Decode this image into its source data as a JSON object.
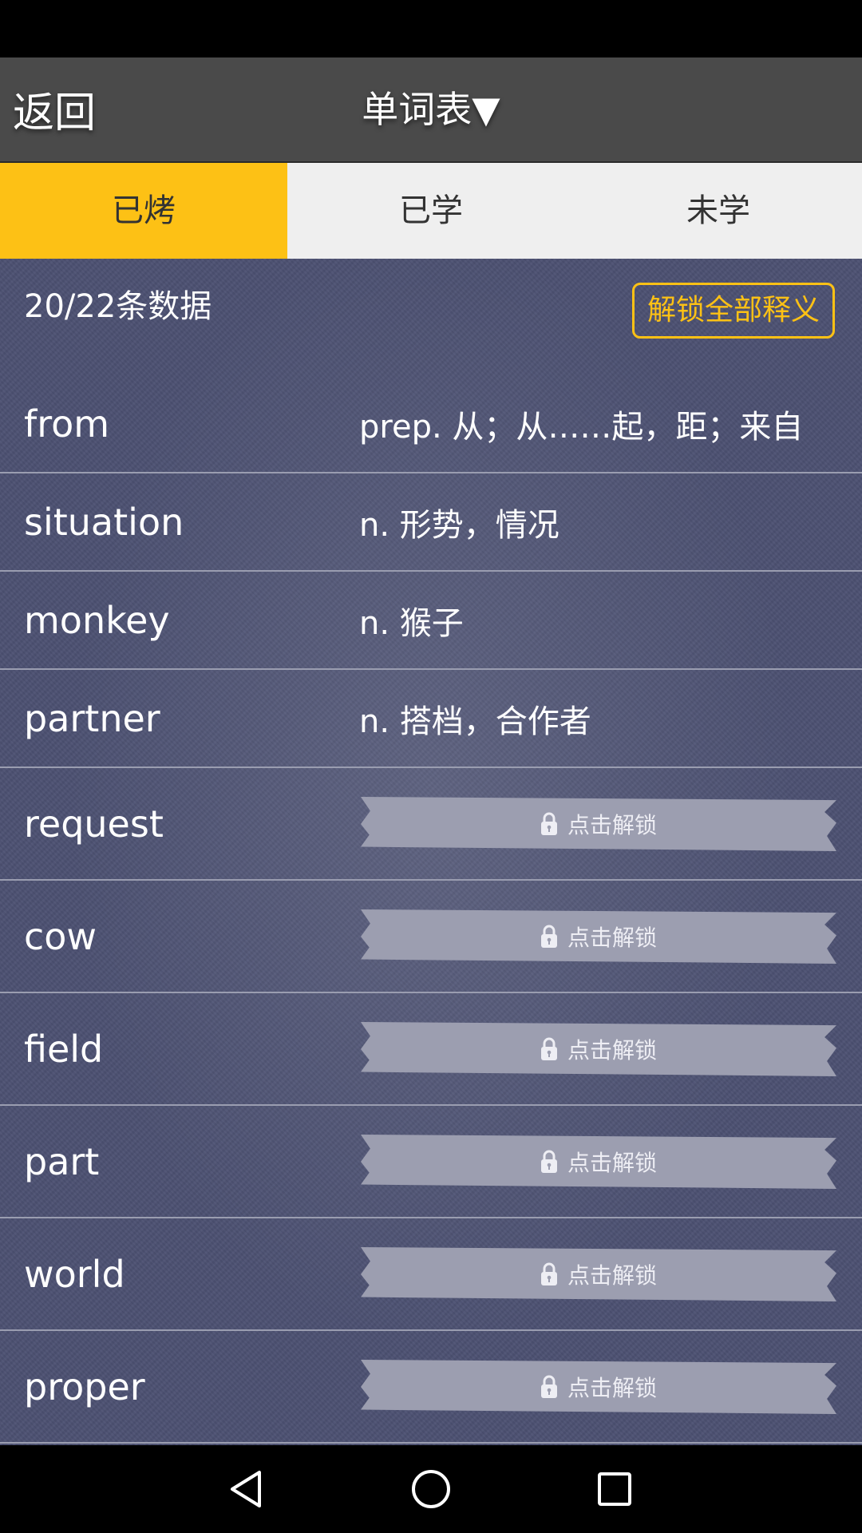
{
  "header": {
    "back_label": "返回",
    "title": "单词表",
    "dropdown_glyph": "▼"
  },
  "tabs": [
    {
      "label": "已烤",
      "active": true
    },
    {
      "label": "已学",
      "active": false
    },
    {
      "label": "未学",
      "active": false
    }
  ],
  "summary": {
    "count_text": "20/22条数据",
    "unlock_all_label": "解锁全部释义"
  },
  "words": [
    {
      "word": "from",
      "meaning": "prep. 从；从……起，距；来自",
      "locked": false
    },
    {
      "word": "situation",
      "meaning": "n. 形势，情况",
      "locked": false
    },
    {
      "word": "monkey",
      "meaning": "n. 猴子",
      "locked": false
    },
    {
      "word": "partner",
      "meaning": "n. 搭档，合作者",
      "locked": false
    },
    {
      "word": "request",
      "locked": true
    },
    {
      "word": "cow",
      "locked": true
    },
    {
      "word": "field",
      "locked": true
    },
    {
      "word": "part",
      "locked": true
    },
    {
      "word": "world",
      "locked": true
    },
    {
      "word": "proper",
      "locked": true
    }
  ],
  "locked_label": "点击解锁",
  "icons": {
    "lock": "lock-icon",
    "back": "back-triangle-icon",
    "home": "home-circle-icon",
    "recents": "recents-square-icon"
  },
  "colors": {
    "accent": "#fdc115",
    "header_bg": "#4a4a4a",
    "list_bg": "#4c5172",
    "tape": "#9c9eb0"
  }
}
